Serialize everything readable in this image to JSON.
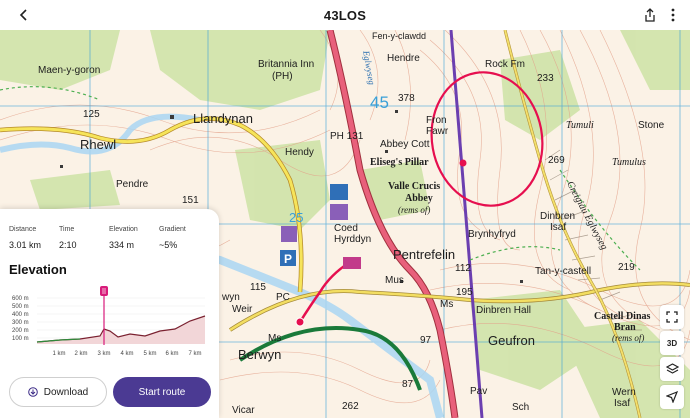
{
  "header": {
    "title": "43LOS",
    "back_icon": "chevron-left-icon",
    "share_icon": "share-icon",
    "more_icon": "more-vertical-icon"
  },
  "stats": [
    {
      "label": "Distance",
      "value": "3.01 km"
    },
    {
      "label": "Time",
      "value": "2:10"
    },
    {
      "label": "Elevation",
      "value": "334 m"
    },
    {
      "label": "Gradient",
      "value": "~5%"
    }
  ],
  "elevation": {
    "title": "Elevation",
    "y_ticks": [
      "600 m",
      "500 m",
      "400 m",
      "300 m",
      "200 m",
      "100 m"
    ],
    "x_ticks": [
      "1 km",
      "2 km",
      "3 km",
      "4 km",
      "5 km",
      "6 km",
      "7 km"
    ],
    "marker_label": "3 km"
  },
  "buttons": {
    "download": "Download",
    "start": "Start route"
  },
  "controls": {
    "threed": "3D"
  },
  "map_labels": {
    "maen": "Maen-y-goron",
    "britannia": "Britannia Inn",
    "ph1": "(PH)",
    "hendre": "Hendre",
    "fen": "Fen-y-clawdd",
    "rockfm": "Rock Fm",
    "n233": "233",
    "llandynan": "Llandynan",
    "rhewl": "Rhewl",
    "n125": "125",
    "n378": "378",
    "n45": "45",
    "tumuli": "Tumuli",
    "stone": "Stone",
    "fron": "Fron",
    "fawr": "Fawr",
    "abbeycott": "Abbey Cott",
    "ph131": "PH 131",
    "hendy": "Hendy",
    "eliseg": "Eliseg's Pillar",
    "valle": "Valle Crucis",
    "abbey": "Abbey",
    "remsof": "(rems of)",
    "n269": "269",
    "tumulus": "Tumulus",
    "creigiau": "Creigiau Eglwyseg",
    "pendre": "Pendre",
    "n151": "151",
    "coed": "Coed",
    "hyrddyn": "Hyrddyn",
    "dinbren": "Dinbren",
    "isaf1": "Isaf",
    "brynhyfryd": "Brynhyfryd",
    "pentrefelin": "Pentrefelin",
    "tanycastell": "Tan-y-castell",
    "n219": "219",
    "n112": "112",
    "n195": "195",
    "mus": "Mus",
    "wyn": "wyn",
    "weir": "Weir",
    "n115": "115",
    "pc": "PC",
    "ms1": "Ms",
    "dinbrenhall": "Dinbren Hall",
    "castell": "Castell Dinas",
    "bran": "Bran",
    "remsof2": "(rems of)",
    "berwyn": "Berwyn",
    "ms2": "Ms",
    "n97": "97",
    "geufron": "Geufron",
    "n87": "87",
    "n262": "262",
    "sch": "Sch",
    "wern": "Wern",
    "isaf2": "Isaf",
    "vicar": "Vicar",
    "pav": "Pav",
    "n25": "25",
    "eglwyseg": "Eglwyseg"
  },
  "colors": {
    "route": "#e60f4f",
    "accent": "#4b3a93",
    "grid": "#3aa0d8",
    "rail": "#7b3fa8"
  }
}
